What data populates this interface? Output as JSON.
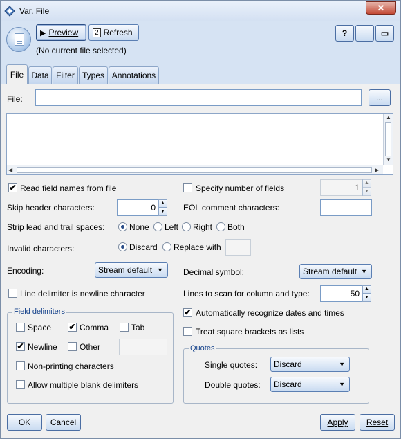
{
  "window": {
    "title": "Var. File",
    "close_glyph": "✕"
  },
  "toolbar": {
    "preview_label": "Preview",
    "refresh_label": "Refresh",
    "help_glyph": "?",
    "minimize_glyph": "_",
    "maximize_glyph": "▭",
    "status": "(No current file selected)"
  },
  "tabs": [
    {
      "label": "File",
      "active": true
    },
    {
      "label": "Data",
      "active": false
    },
    {
      "label": "Filter",
      "active": false
    },
    {
      "label": "Types",
      "active": false
    },
    {
      "label": "Annotations",
      "active": false
    }
  ],
  "file": {
    "label": "File:",
    "value": "",
    "browse_label": "..."
  },
  "options": {
    "read_field_names": {
      "label": "Read field names from file",
      "checked": true
    },
    "specify_fields": {
      "label": "Specify number of fields",
      "checked": false,
      "value": "1"
    },
    "skip_header": {
      "label": "Skip header characters:",
      "value": "0"
    },
    "eol_comment": {
      "label": "EOL comment characters:",
      "value": ""
    },
    "strip_spaces": {
      "label": "Strip lead and trail spaces:",
      "options": [
        "None",
        "Left",
        "Right",
        "Both"
      ],
      "selected": "None"
    },
    "invalid_chars": {
      "label": "Invalid characters:",
      "options": [
        "Discard",
        "Replace with"
      ],
      "selected": "Discard",
      "replace_value": ""
    },
    "encoding": {
      "label": "Encoding:",
      "value": "Stream default"
    },
    "decimal_symbol": {
      "label": "Decimal symbol:",
      "value": "Stream default"
    },
    "line_delimiter": {
      "label": "Line delimiter is newline character",
      "checked": false
    },
    "lines_to_scan": {
      "label": "Lines to scan for column and type:",
      "value": "50"
    },
    "auto_dates": {
      "label": "Automatically recognize dates and times",
      "checked": true
    },
    "square_brackets": {
      "label": "Treat square brackets as lists",
      "checked": false
    }
  },
  "field_delimiters": {
    "title": "Field delimiters",
    "space": {
      "label": "Space",
      "checked": false
    },
    "comma": {
      "label": "Comma",
      "checked": true
    },
    "tab": {
      "label": "Tab",
      "checked": false
    },
    "newline": {
      "label": "Newline",
      "checked": true
    },
    "other": {
      "label": "Other",
      "checked": false,
      "value": ""
    },
    "non_printing": {
      "label": "Non-printing characters",
      "checked": false
    },
    "multiple_blank": {
      "label": "Allow multiple blank delimiters",
      "checked": false
    }
  },
  "quotes": {
    "title": "Quotes",
    "single": {
      "label": "Single quotes:",
      "value": "Discard"
    },
    "double": {
      "label": "Double quotes:",
      "value": "Discard"
    }
  },
  "footer": {
    "ok_label": "OK",
    "cancel_label": "Cancel",
    "apply_label": "Apply",
    "reset_label": "Reset"
  }
}
